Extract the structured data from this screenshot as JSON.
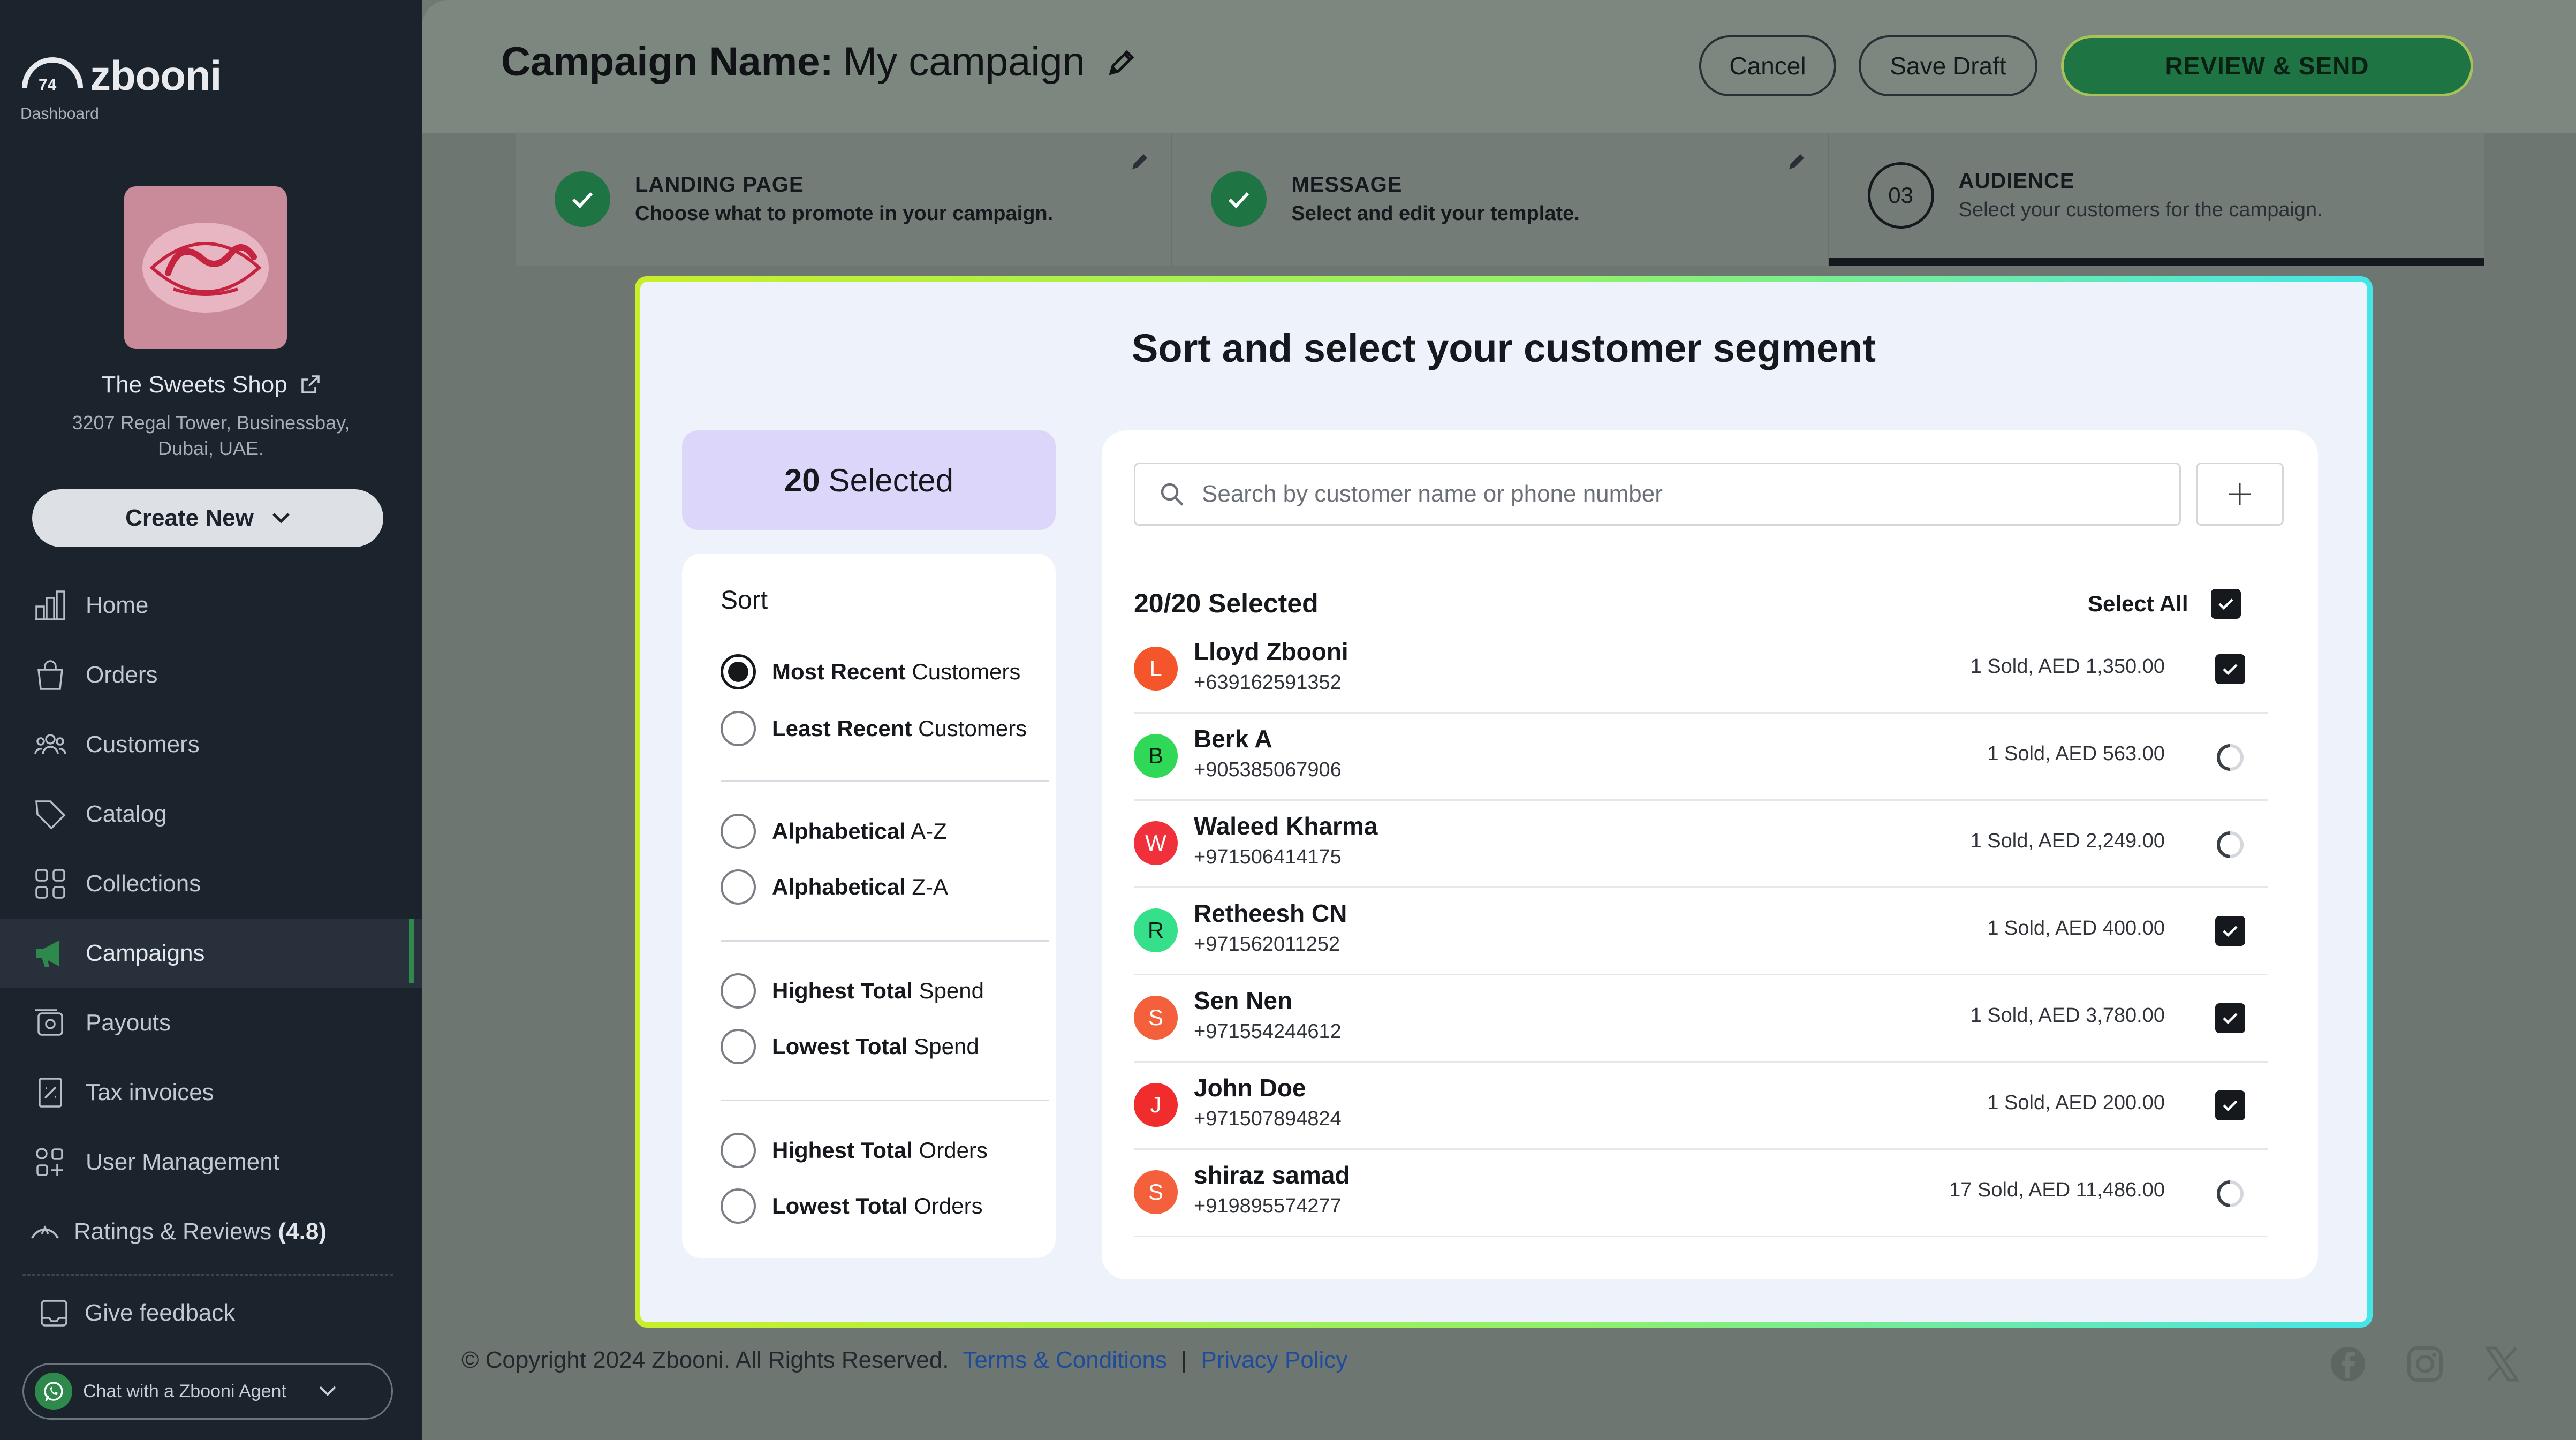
{
  "brand": {
    "name": "zbooni",
    "subtitle": "Dashboard"
  },
  "shop": {
    "name": "The Sweets Shop",
    "address_line1": "3207 Regal Tower, Businessbay,",
    "address_line2": "Dubai, UAE."
  },
  "sidebar": {
    "create_label": "Create New",
    "items": [
      {
        "label": "Home",
        "icon": "chart-icon"
      },
      {
        "label": "Orders",
        "icon": "bag-icon"
      },
      {
        "label": "Customers",
        "icon": "users-icon"
      },
      {
        "label": "Catalog",
        "icon": "tag-icon"
      },
      {
        "label": "Collections",
        "icon": "grid-icon"
      },
      {
        "label": "Campaigns",
        "icon": "megaphone-icon"
      },
      {
        "label": "Payouts",
        "icon": "payout-icon"
      },
      {
        "label": "Tax invoices",
        "icon": "invoice-icon"
      },
      {
        "label": "User Management",
        "icon": "user-manage-icon"
      }
    ],
    "ratings_label": "Ratings & Reviews",
    "ratings_value": "(4.8)",
    "feedback_label": "Give feedback",
    "chat_label": "Chat with a Zbooni Agent"
  },
  "header": {
    "title_label": "Campaign Name:",
    "title_value": "My campaign",
    "cancel_label": "Cancel",
    "save_label": "Save Draft",
    "review_label": "REVIEW & SEND"
  },
  "steps": [
    {
      "title": "LANDING PAGE",
      "desc": "Choose what to promote in your campaign.",
      "status": "done"
    },
    {
      "title": "MESSAGE",
      "desc": "Select and edit your template.",
      "status": "done"
    },
    {
      "number": "03",
      "title": "AUDIENCE",
      "desc": "Select your customers for the campaign.",
      "status": "current"
    }
  ],
  "modal": {
    "title": "Sort and select your customer segment",
    "selected_count": "20",
    "selected_label": "Selected",
    "sort_title": "Sort",
    "sort_options": [
      {
        "bold": "Most Recent",
        "rest": " Customers",
        "selected": true
      },
      {
        "bold": "Least Recent",
        "rest": " Customers",
        "selected": false
      },
      {
        "bold": "Alphabetical",
        "rest": " A-Z",
        "selected": false
      },
      {
        "bold": "Alphabetical",
        "rest": " Z-A",
        "selected": false
      },
      {
        "bold": "Highest Total",
        "rest": " Spend",
        "selected": false
      },
      {
        "bold": "Lowest Total",
        "rest": " Spend",
        "selected": false
      },
      {
        "bold": "Highest Total",
        "rest": " Orders",
        "selected": false
      },
      {
        "bold": "Lowest Total",
        "rest": " Orders",
        "selected": false
      }
    ],
    "search_placeholder": "Search by customer name or phone number",
    "list_count": "20/20 Selected",
    "select_all_label": "Select All",
    "select_all_checked": true,
    "customers": [
      {
        "initial": "L",
        "name": "Lloyd Zbooni",
        "phone": "+639162591352",
        "sold": "1 Sold, AED 1,350.00",
        "state": "checked",
        "color": "#f4552a"
      },
      {
        "initial": "B",
        "name": "Berk A",
        "phone": "+905385067906",
        "sold": "1 Sold, AED 563.00",
        "state": "loading",
        "color": "#2fd957"
      },
      {
        "initial": "W",
        "name": "Waleed Kharma",
        "phone": "+971506414175",
        "sold": "1 Sold, AED 2,249.00",
        "state": "loading",
        "color": "#f0303a"
      },
      {
        "initial": "R",
        "name": "Retheesh CN",
        "phone": "+971562011252",
        "sold": "1 Sold, AED 400.00",
        "state": "checked",
        "color": "#36e08a"
      },
      {
        "initial": "S",
        "name": "Sen Nen",
        "phone": "+971554244612",
        "sold": "1 Sold, AED 3,780.00",
        "state": "checked",
        "color": "#f4603c"
      },
      {
        "initial": "J",
        "name": "John Doe",
        "phone": "+971507894824",
        "sold": "1 Sold, AED 200.00",
        "state": "checked",
        "color": "#f02c2c"
      },
      {
        "initial": "S",
        "name": "shiraz samad",
        "phone": "+919895574277",
        "sold": "17 Sold, AED 11,486.00",
        "state": "loading",
        "color": "#f4603c"
      }
    ]
  },
  "footer": {
    "copyright": "© Copyright 2024 Zbooni. All Rights Reserved.",
    "terms": "Terms & Conditions",
    "separator": "|",
    "privacy": "Privacy Policy",
    "social_icons": [
      "facebook-icon",
      "instagram-icon",
      "x-icon"
    ]
  },
  "colors": {
    "sidebar_bg": "#1b232d",
    "accent_green": "#1e7442",
    "selected_card": "#dcd6fb"
  }
}
